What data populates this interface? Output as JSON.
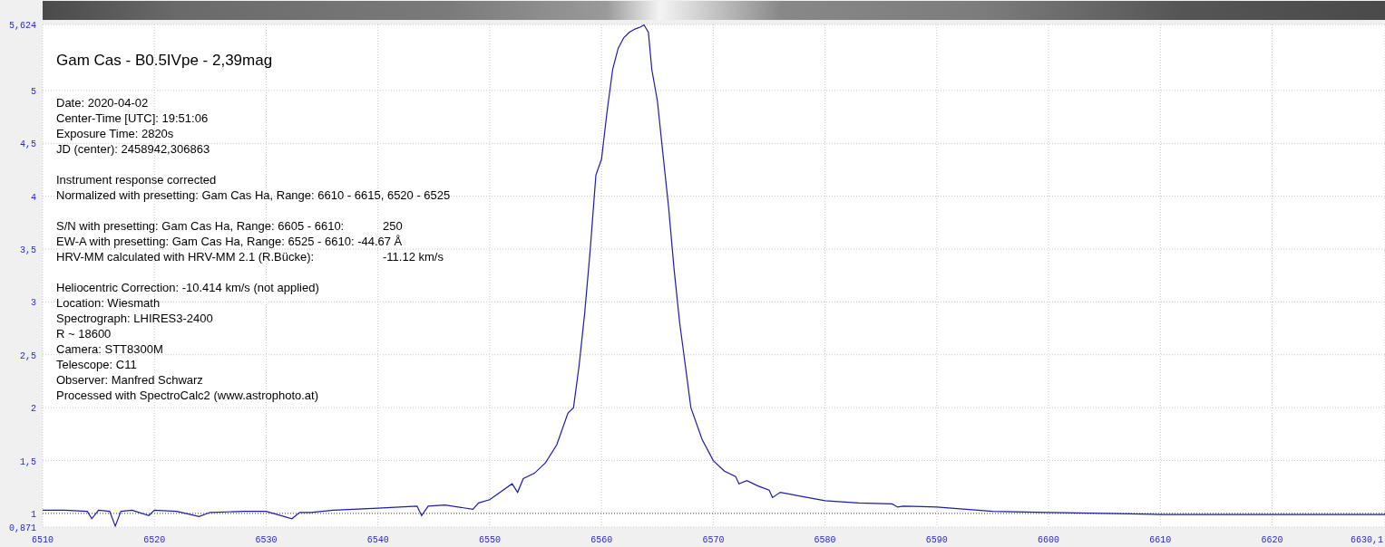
{
  "chart_data": {
    "type": "line",
    "grid": true,
    "ref_lines": [
      {
        "axis": "y",
        "value": 1
      }
    ],
    "xlim": [
      6510,
      6630.1
    ],
    "ylim": [
      0.871,
      5.624
    ],
    "xticks": [
      6510,
      6520,
      6530,
      6540,
      6550,
      6560,
      6570,
      6580,
      6590,
      6600,
      6610,
      6620,
      {
        "value": 6630.1,
        "label": "6630,1"
      }
    ],
    "yticks": [
      {
        "value": 0.871,
        "label": "0,871"
      },
      1,
      {
        "value": 1.5,
        "label": "1,5"
      },
      2,
      {
        "value": 2.5,
        "label": "2,5"
      },
      3,
      {
        "value": 3.5,
        "label": "3,5"
      },
      4,
      {
        "value": 4.5,
        "label": "4,5"
      },
      5,
      {
        "value": 5.624,
        "label": "5,624"
      }
    ],
    "x": [
      6510,
      6512,
      6514,
      6514.4,
      6515,
      6516,
      6516.5,
      6517,
      6518,
      6519.5,
      6520,
      6522,
      6524,
      6525,
      6528,
      6530,
      6532.3,
      6533,
      6534,
      6536,
      6540,
      6543.5,
      6543.9,
      6544.5,
      6546,
      6548.5,
      6549,
      6550,
      6552,
      6552.5,
      6553,
      6554,
      6555,
      6556,
      6557,
      6557.5,
      6558,
      6558.5,
      6559,
      6559.5,
      6560,
      6560.5,
      6561,
      6561.5,
      6562,
      6562.5,
      6563,
      6563.5,
      6563.8,
      6564.2,
      6564.5,
      6565,
      6565.5,
      6566,
      6566.5,
      6567,
      6567.5,
      6568,
      6569,
      6570,
      6571,
      6572,
      6572.3,
      6573,
      6574,
      6575,
      6575.3,
      6576,
      6578,
      6580,
      6583,
      6586,
      6586.5,
      6587,
      6590,
      6595,
      6600,
      6605,
      6610,
      6615,
      6620,
      6625,
      6630.1
    ],
    "series": [
      {
        "color": "#1c1ca8",
        "values": [
          1.03,
          1.03,
          1.02,
          0.95,
          1.03,
          1.02,
          0.88,
          1.02,
          1.03,
          0.98,
          1.03,
          1.02,
          0.97,
          1.01,
          1.02,
          1.02,
          0.95,
          1.01,
          1.01,
          1.03,
          1.05,
          1.07,
          0.98,
          1.07,
          1.08,
          1.04,
          1.1,
          1.13,
          1.28,
          1.2,
          1.33,
          1.38,
          1.48,
          1.65,
          1.95,
          2.0,
          2.4,
          2.9,
          3.5,
          4.2,
          4.35,
          4.8,
          5.2,
          5.4,
          5.5,
          5.55,
          5.58,
          5.6,
          5.62,
          5.55,
          5.2,
          4.9,
          4.4,
          3.9,
          3.3,
          2.8,
          2.4,
          2.0,
          1.7,
          1.5,
          1.4,
          1.35,
          1.28,
          1.31,
          1.26,
          1.22,
          1.15,
          1.2,
          1.16,
          1.12,
          1.1,
          1.09,
          1.06,
          1.07,
          1.06,
          1.02,
          1.01,
          1.0,
          0.99,
          0.99,
          0.99,
          0.99,
          0.99
        ]
      }
    ]
  },
  "info": {
    "title": "Gam Cas - B0.5IVpe - 2,39mag",
    "groups": [
      [
        {
          "text": "Date: 2020-04-02"
        },
        {
          "text": "Center-Time [UTC]: 19:51:06"
        },
        {
          "text": "Exposure Time: 2820s"
        },
        {
          "text": "JD (center): 2458942,306863"
        }
      ],
      [
        {
          "text": "Instrument response corrected"
        },
        {
          "text": "Normalized with presetting: Gam Cas Ha, Range: 6610 - 6615, 6520 - 6525"
        }
      ],
      [
        {
          "text": "S/N with presetting: Gam Cas Ha, Range: 6605 - 6610:",
          "value": "250"
        },
        {
          "text": "EW-A with presetting: Gam Cas Ha, Range: 6525 - 6610: -44.67 Å"
        },
        {
          "text": "HRV-MM calculated with HRV-MM 2.1 (R.Bücke):",
          "value": "-11.12 km/s"
        }
      ],
      [
        {
          "text": "Heliocentric Correction: -10.414 km/s (not applied)"
        },
        {
          "text": "Location: Wiesmath"
        },
        {
          "text": "Spectrograph: LHIRES3-2400"
        },
        {
          "text": "R ~ 18600"
        },
        {
          "text": "Camera: STT8300M"
        },
        {
          "text": "Telescope: C11"
        },
        {
          "text": "Observer: Manfred Schwarz"
        },
        {
          "text": "Processed with SpectroCalc2 (www.astrophoto.at)"
        }
      ]
    ]
  }
}
